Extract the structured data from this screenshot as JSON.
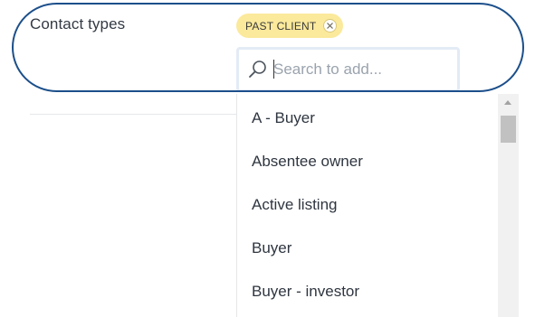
{
  "field": {
    "label": "Contact types"
  },
  "selected_tags": [
    {
      "label": "PAST CLIENT",
      "remove_icon": "close-icon"
    }
  ],
  "search": {
    "placeholder": "Search to add...",
    "value": "",
    "icon": "search-icon"
  },
  "options": [
    "A - Buyer",
    "Absentee owner",
    "Active listing",
    "Buyer",
    "Buyer - investor"
  ],
  "colors": {
    "tag_background": "#fbe99c",
    "highlight_ring": "#1c4f8a",
    "search_border": "#e3ebf5",
    "text": "#2f3640"
  }
}
